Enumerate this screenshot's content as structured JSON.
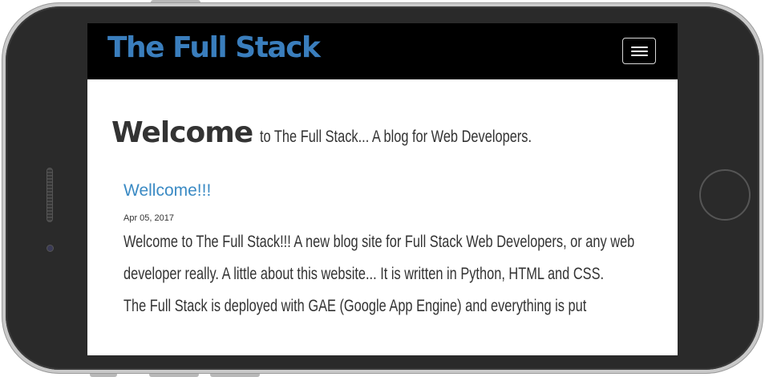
{
  "navbar": {
    "brand": "The Full Stack"
  },
  "intro": {
    "welcome": "Welcome",
    "tagline": "to The Full Stack... A blog for Web Developers."
  },
  "post": {
    "title": "Wellcome!!!",
    "date": "Apr 05, 2017",
    "paragraph1": "Welcome to The Full Stack!!! A new blog site for Full Stack Web Developers, or any web developer really. A little about this website... It is written in Python, HTML and CSS.",
    "paragraph2": "The Full Stack is deployed with GAE (Google App Engine) and everything is put"
  },
  "colors": {
    "navbar_bg": "#000000",
    "brand": "#3a7ebd",
    "link": "#3a8ac4",
    "text": "#333333"
  },
  "icons": {
    "menu": "hamburger-menu-icon"
  }
}
